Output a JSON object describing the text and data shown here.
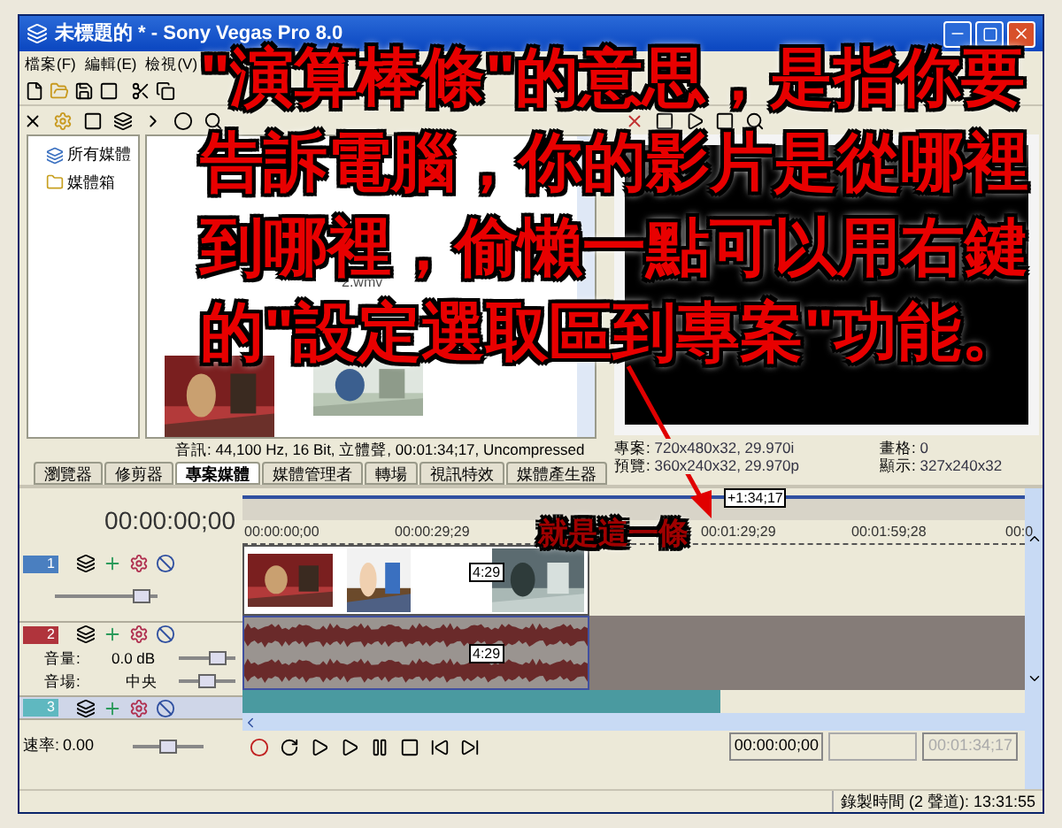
{
  "window": {
    "title": "未標題的 * - Sony Vegas Pro 8.0"
  },
  "menu": [
    "檔案(F)",
    "編輯(E)",
    "檢視(V)"
  ],
  "explorer": {
    "items": [
      {
        "label": "所有媒體",
        "kind": "all"
      },
      {
        "label": "媒體箱",
        "kind": "bin"
      }
    ]
  },
  "media": {
    "file_label": "2.wmv",
    "info": "音訊: 44,100 Hz, 16 Bit, 立體聲, 00:01:34;17, Uncompressed"
  },
  "tabs": [
    {
      "label": "瀏覽器",
      "selected": false
    },
    {
      "label": "修剪器",
      "selected": false
    },
    {
      "label": "專案媒體",
      "selected": true
    },
    {
      "label": "媒體管理者",
      "selected": false
    },
    {
      "label": "轉場",
      "selected": false
    },
    {
      "label": "視訊特效",
      "selected": false
    },
    {
      "label": "媒體產生器",
      "selected": false
    }
  ],
  "preview": {
    "info": [
      {
        "label": "專案:",
        "value": "720x480x32, 29.970i"
      },
      {
        "label": "畫格:",
        "value": "0"
      },
      {
        "label": "預覽:",
        "value": "360x240x32, 29.970p"
      },
      {
        "label": "顯示:",
        "value": "327x240x32"
      }
    ]
  },
  "timeline": {
    "time": "00:00:00;00",
    "region_label": "+1:34;17",
    "ruler": [
      "00:00:00;00",
      "00:00:29;29",
      "00:01:29;29",
      "00:01:59;28",
      "00:0"
    ],
    "tracks": [
      {
        "number": "1",
        "kind": "video",
        "clip_label": "4:29",
        "level": 0.85
      },
      {
        "number": "2",
        "kind": "audio",
        "clip_label": "4:29",
        "volume_label": "音量:",
        "volume": "0.0 dB",
        "volume_slider": {
          "level": 0.7
        },
        "pan_label": "音場:",
        "pan": "中央",
        "pan_slider": {
          "level": 0.5
        }
      },
      {
        "number": "3",
        "kind": "music"
      }
    ],
    "rate_label": "速率:",
    "rate": "0.00",
    "rate_slider": {
      "level": 0.5
    },
    "time_fields": [
      {
        "value": "00:00:00;00",
        "disabled": false
      },
      {
        "value": "00:01:34;17",
        "disabled": true
      }
    ]
  },
  "status_bar": "錄製時間 (2 聲道): 13:31:55",
  "annotation": {
    "lines": [
      "\"演算棒條\"的意思，是指你要",
      "告訴電腦，你的影片是從哪裡",
      "到哪裡，偷懶一點可以用右鍵",
      "的\"設定選取區到專案\"功能。"
    ],
    "callout": "就是這一條"
  }
}
